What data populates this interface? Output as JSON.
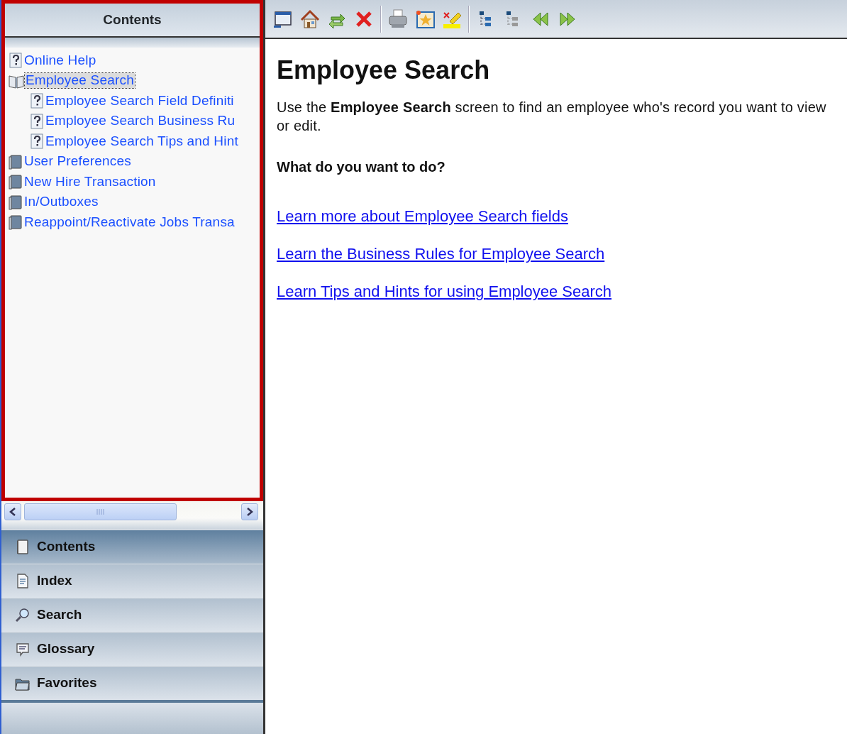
{
  "contents_panel": {
    "title": "Contents",
    "tree": [
      {
        "label": "Online Help",
        "kind": "topic",
        "selected": false
      },
      {
        "label": "Employee Search",
        "kind": "book",
        "expanded": true,
        "selected": true,
        "children": [
          {
            "label": "Employee Search Field Definiti",
            "kind": "topic",
            "selected": false
          },
          {
            "label": "Employee Search Business Ru",
            "kind": "topic",
            "selected": false
          },
          {
            "label": "Employee Search Tips and Hint",
            "kind": "topic",
            "selected": false
          }
        ]
      },
      {
        "label": "User Preferences",
        "kind": "book",
        "expanded": false,
        "selected": false
      },
      {
        "label": "New Hire Transaction",
        "kind": "book",
        "expanded": false,
        "selected": false
      },
      {
        "label": "In/Outboxes",
        "kind": "book",
        "expanded": false,
        "selected": false
      },
      {
        "label": "Reappoint/Reactivate Jobs Transa",
        "kind": "book",
        "expanded": false,
        "selected": false
      }
    ]
  },
  "nav_tabs": [
    {
      "label": "Contents",
      "kind": "contents",
      "selected": true
    },
    {
      "label": "Index",
      "kind": "index",
      "selected": false
    },
    {
      "label": "Search",
      "kind": "search",
      "selected": false
    },
    {
      "label": "Glossary",
      "kind": "glossary",
      "selected": false
    },
    {
      "label": "Favorites",
      "kind": "favorites",
      "selected": false
    }
  ],
  "toolbar": [
    {
      "kind": "window"
    },
    {
      "kind": "home"
    },
    {
      "kind": "sync"
    },
    {
      "kind": "close"
    },
    {
      "kind": "sep"
    },
    {
      "kind": "print"
    },
    {
      "kind": "favorite"
    },
    {
      "kind": "highlight"
    },
    {
      "kind": "sep"
    },
    {
      "kind": "expand"
    },
    {
      "kind": "collapse"
    },
    {
      "kind": "prev"
    },
    {
      "kind": "next"
    }
  ],
  "article": {
    "title": "Employee Search",
    "intro": "Use the **Employee Search** screen to find an employee who's record you want to view or edit.",
    "subheading": "What do you want to do?",
    "links": [
      "Learn more about Employee Search fields",
      "Learn the Business Rules for Employee Search",
      "Learn Tips and Hints for using Employee Search"
    ]
  }
}
